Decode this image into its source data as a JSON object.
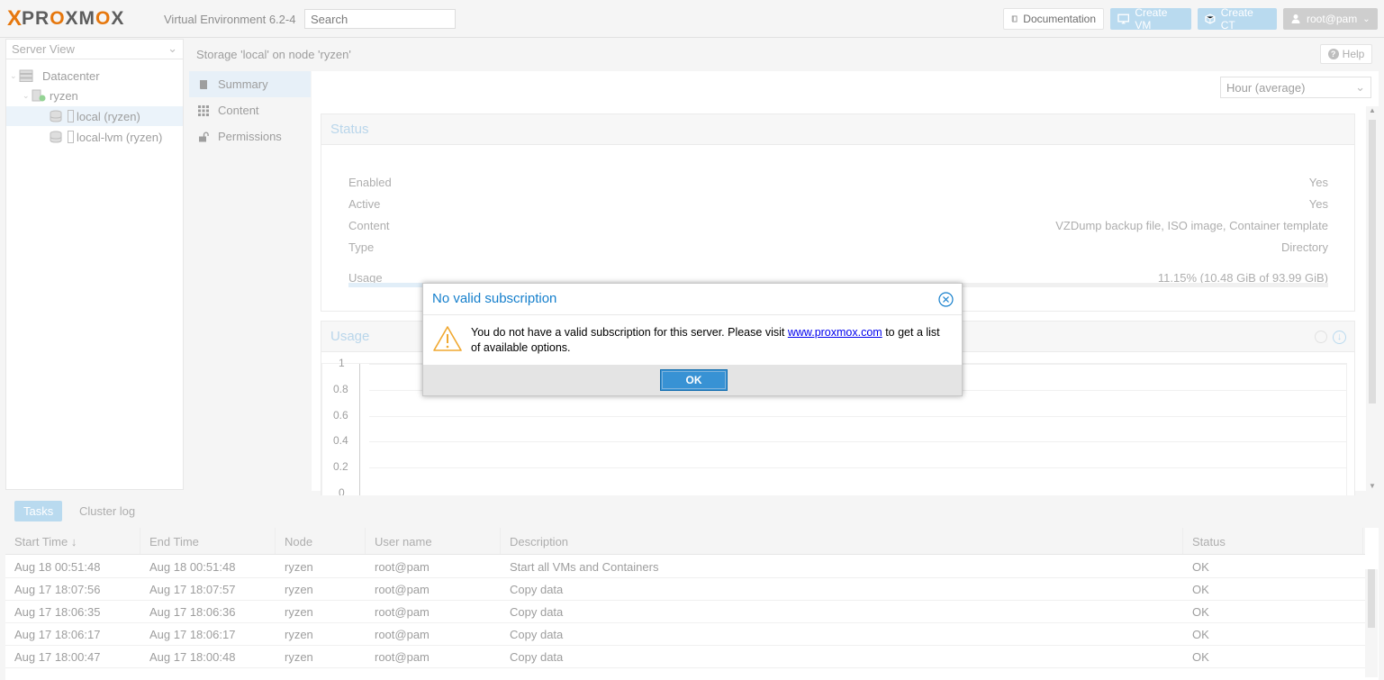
{
  "topbar": {
    "logo_x": "X",
    "logo_text_a": "PR",
    "logo_text_o1": "O",
    "logo_text_b": "XM",
    "logo_text_o2": "O",
    "logo_text_c": "X",
    "version": "Virtual Environment 6.2-4",
    "search_placeholder": "Search",
    "documentation_label": "Documentation",
    "create_vm_label": "Create VM",
    "create_ct_label": "Create CT",
    "user_label": "root@pam"
  },
  "tree": {
    "view_label": "Server View",
    "items": [
      {
        "label": "Datacenter"
      },
      {
        "label": "ryzen"
      },
      {
        "label": "local (ryzen)"
      },
      {
        "label": "local-lvm (ryzen)"
      }
    ]
  },
  "breadcrumb": {
    "title": "Storage 'local' on node 'ryzen'",
    "help_label": "Help"
  },
  "submenu": {
    "items": [
      {
        "label": "Summary"
      },
      {
        "label": "Content"
      },
      {
        "label": "Permissions"
      }
    ]
  },
  "summary": {
    "range_label": "Hour (average)",
    "status_title": "Status",
    "rows": [
      {
        "key": "Enabled",
        "value": "Yes"
      },
      {
        "key": "Active",
        "value": "Yes"
      },
      {
        "key": "Content",
        "value": "VZDump backup file, ISO image, Container template"
      },
      {
        "key": "Type",
        "value": "Directory"
      },
      {
        "key": "Usage",
        "value": "11.15% (10.48 GiB of 93.99 GiB)"
      }
    ],
    "usage_fraction": 0.1115,
    "usage_title": "Usage",
    "y_ticks": [
      "1",
      "0.8",
      "0.6",
      "0.4",
      "0.2",
      "0"
    ]
  },
  "bottom": {
    "tabs": [
      "Tasks",
      "Cluster log"
    ],
    "columns": [
      "Start Time",
      "End Time",
      "Node",
      "User name",
      "Description",
      "Status"
    ],
    "sort_indicator": "↓",
    "rows": [
      [
        "Aug 18 00:51:48",
        "Aug 18 00:51:48",
        "ryzen",
        "root@pam",
        "Start all VMs and Containers",
        "OK"
      ],
      [
        "Aug 17 18:07:56",
        "Aug 17 18:07:57",
        "ryzen",
        "root@pam",
        "Copy data",
        "OK"
      ],
      [
        "Aug 17 18:06:35",
        "Aug 17 18:06:36",
        "ryzen",
        "root@pam",
        "Copy data",
        "OK"
      ],
      [
        "Aug 17 18:06:17",
        "Aug 17 18:06:17",
        "ryzen",
        "root@pam",
        "Copy data",
        "OK"
      ],
      [
        "Aug 17 18:00:47",
        "Aug 17 18:00:48",
        "ryzen",
        "root@pam",
        "Copy data",
        "OK"
      ]
    ]
  },
  "dialog": {
    "title": "No valid subscription",
    "message_before": "You do not have a valid subscription for this server. Please visit ",
    "link_text": "www.proxmox.com",
    "message_after": " to get a list of available options.",
    "ok_label": "OK"
  },
  "colors": {
    "accent": "#157fcc",
    "brand_orange": "#e57000",
    "ok_button": "#3892d4"
  }
}
